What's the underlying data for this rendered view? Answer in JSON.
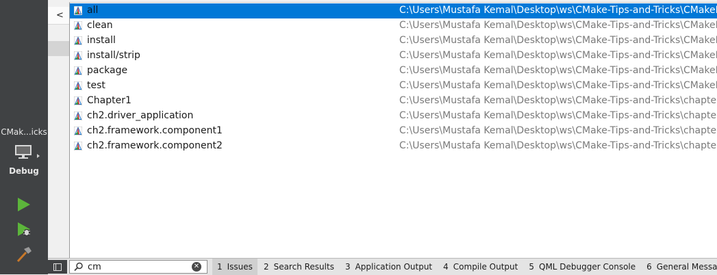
{
  "left_bar": {
    "kit_name": "CMak...icks",
    "kit_mode": "Debug",
    "icons": {
      "monitor": "monitor-icon",
      "run": "play-icon",
      "debug_run": "debug-play-icon",
      "build": "hammer-icon"
    },
    "run_color": "#5cb53b"
  },
  "nav": {
    "back_label": "<"
  },
  "locator": {
    "selected_color": "#0078d7",
    "results": [
      {
        "name": "all",
        "path": "C:\\Users\\Mustafa Kemal\\Desktop\\ws\\CMake-Tips-and-Tricks\\CMakeLi...",
        "selected": true
      },
      {
        "name": "clean",
        "path": "C:\\Users\\Mustafa Kemal\\Desktop\\ws\\CMake-Tips-and-Tricks\\CMakeLi..."
      },
      {
        "name": "install",
        "path": "C:\\Users\\Mustafa Kemal\\Desktop\\ws\\CMake-Tips-and-Tricks\\CMakeLi..."
      },
      {
        "name": "install/strip",
        "path": "C:\\Users\\Mustafa Kemal\\Desktop\\ws\\CMake-Tips-and-Tricks\\CMakeLi..."
      },
      {
        "name": "package",
        "path": "C:\\Users\\Mustafa Kemal\\Desktop\\ws\\CMake-Tips-and-Tricks\\CMakeLi..."
      },
      {
        "name": "test",
        "path": "C:\\Users\\Mustafa Kemal\\Desktop\\ws\\CMake-Tips-and-Tricks\\CMakeLi..."
      },
      {
        "name": "Chapter1",
        "path": "C:\\Users\\Mustafa Kemal\\Desktop\\ws\\CMake-Tips-and-Tricks\\chapter_..."
      },
      {
        "name": "ch2.driver_application",
        "path": "C:\\Users\\Mustafa Kemal\\Desktop\\ws\\CMake-Tips-and-Tricks\\chapter_..."
      },
      {
        "name": "ch2.framework.component1",
        "path": "C:\\Users\\Mustafa Kemal\\Desktop\\ws\\CMake-Tips-and-Tricks\\chapter_..."
      },
      {
        "name": "ch2.framework.component2",
        "path": "C:\\Users\\Mustafa Kemal\\Desktop\\ws\\CMake-Tips-and-Tricks\\chapter_..."
      }
    ]
  },
  "bottom_bar": {
    "search_value": "cm",
    "clear_icon": "clear-icon",
    "panes": [
      {
        "num": "1",
        "label": "Issues",
        "active": true
      },
      {
        "num": "2",
        "label": "Search Results"
      },
      {
        "num": "3",
        "label": "Application Output"
      },
      {
        "num": "4",
        "label": "Compile Output"
      },
      {
        "num": "5",
        "label": "QML Debugger Console"
      },
      {
        "num": "6",
        "label": "General Messages"
      }
    ]
  }
}
